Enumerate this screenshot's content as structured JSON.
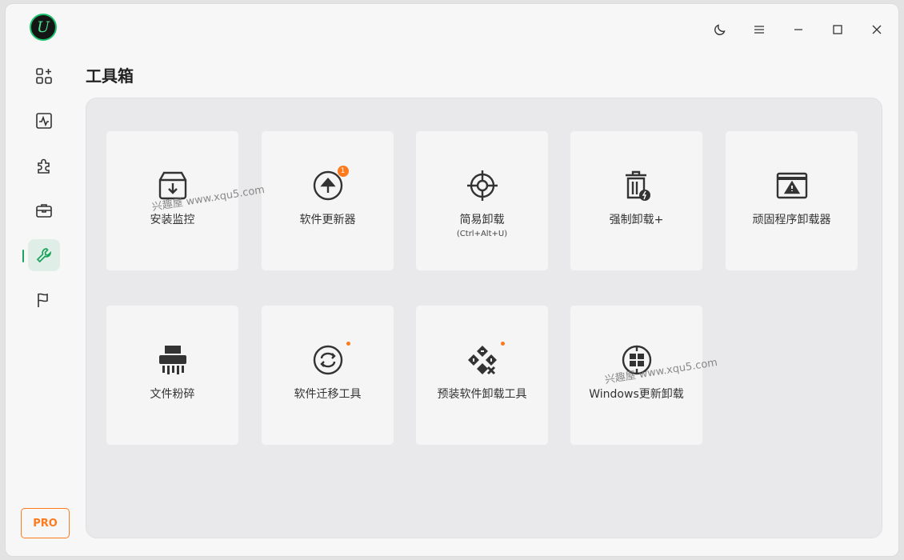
{
  "app": {
    "logo_letter": "U"
  },
  "page": {
    "title": "工具箱"
  },
  "pro_label": "PRO",
  "tools": [
    {
      "label": "安装监控",
      "icon": "install-monitor-icon"
    },
    {
      "label": "软件更新器",
      "icon": "software-updater-icon",
      "badge": "1"
    },
    {
      "label": "简易卸载",
      "sub": "(Ctrl+Alt+U)",
      "icon": "easy-uninstall-icon"
    },
    {
      "label": "强制卸载+",
      "icon": "force-uninstall-icon"
    },
    {
      "label": "顽固程序卸载器",
      "icon": "stubborn-uninstaller-icon"
    },
    {
      "label": "文件粉碎",
      "icon": "file-shredder-icon"
    },
    {
      "label": "软件迁移工具",
      "icon": "software-migration-icon",
      "dot": true
    },
    {
      "label": "预装软件卸载工具",
      "icon": "preinstalled-uninstall-icon",
      "dot": true
    },
    {
      "label": "Windows更新卸载",
      "icon": "windows-update-uninstall-icon"
    }
  ],
  "watermarks": [
    "兴趣屋 www.xqu5.com",
    "兴趣屋 www.xqu5.com"
  ],
  "colors": {
    "accent": "#19a35b",
    "pro": "#ff7a1c",
    "badge": "#ff7a1c"
  }
}
